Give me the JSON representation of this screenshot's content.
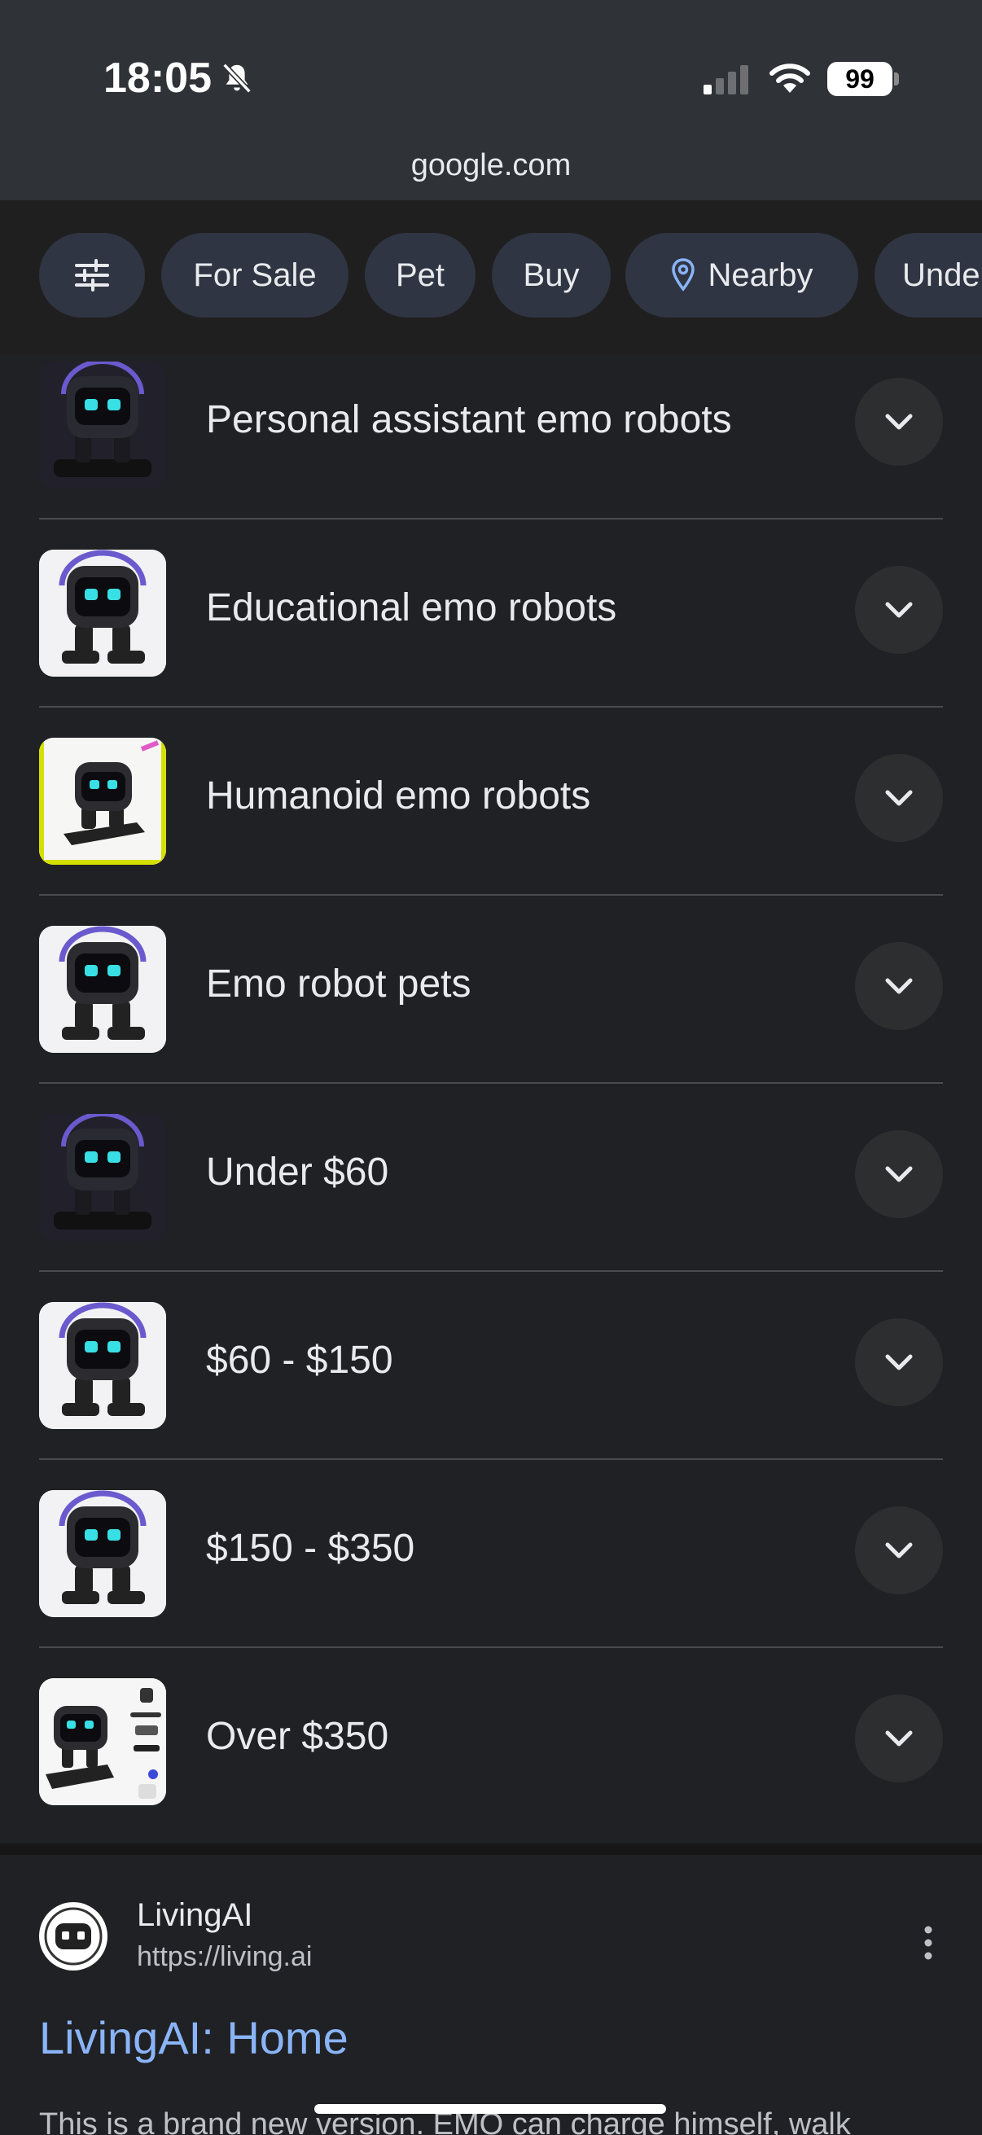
{
  "status_bar": {
    "time": "18:05",
    "battery": "99"
  },
  "address_bar": {
    "domain": "google.com"
  },
  "chips": [
    "For Sale",
    "Pet",
    "Buy",
    "Nearby",
    "Unde"
  ],
  "list": [
    {
      "label": "Personal assistant emo robots"
    },
    {
      "label": "Educational emo robots"
    },
    {
      "label": "Humanoid emo robots"
    },
    {
      "label": "Emo robot pets"
    },
    {
      "label": "Under $60"
    },
    {
      "label": "$60 - $150"
    },
    {
      "label": "$150 - $350"
    },
    {
      "label": "Over $350"
    }
  ],
  "result": {
    "site_name": "LivingAI",
    "site_url": "https://living.ai",
    "title": "LivingAI: Home",
    "snippet": "This is a brand new version. EMO can charge himself, walk"
  },
  "colors": {
    "link": "#8ab4f8",
    "chip_bg": "#2f3542",
    "background": "#202124"
  }
}
